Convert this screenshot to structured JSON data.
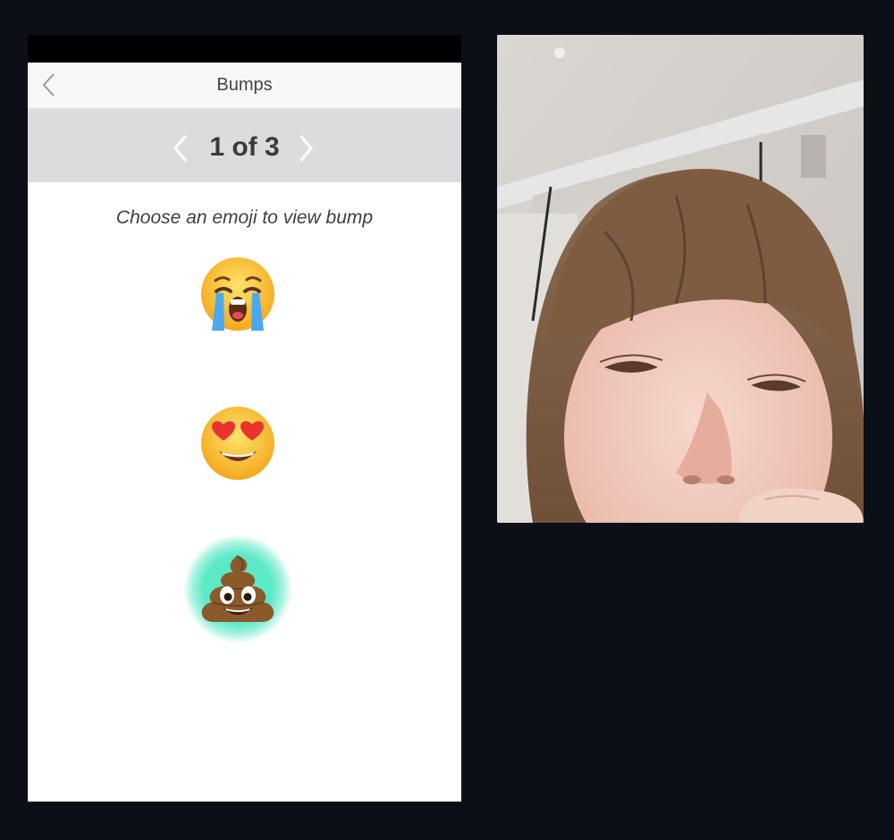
{
  "nav": {
    "title": "Bumps",
    "back_icon": "chevron-left-icon"
  },
  "pager": {
    "text": "1 of 3",
    "prev_icon": "chevron-left-icon",
    "next_icon": "chevron-right-icon"
  },
  "content": {
    "instruction": "Choose an emoji to view bump",
    "emojis": [
      {
        "name": "crying-face-emoji"
      },
      {
        "name": "heart-eyes-emoji"
      },
      {
        "name": "pile-of-poo-emoji",
        "highlighted": true
      }
    ]
  },
  "colors": {
    "background": "#0d0f17",
    "highlight": "#5de8c8"
  }
}
